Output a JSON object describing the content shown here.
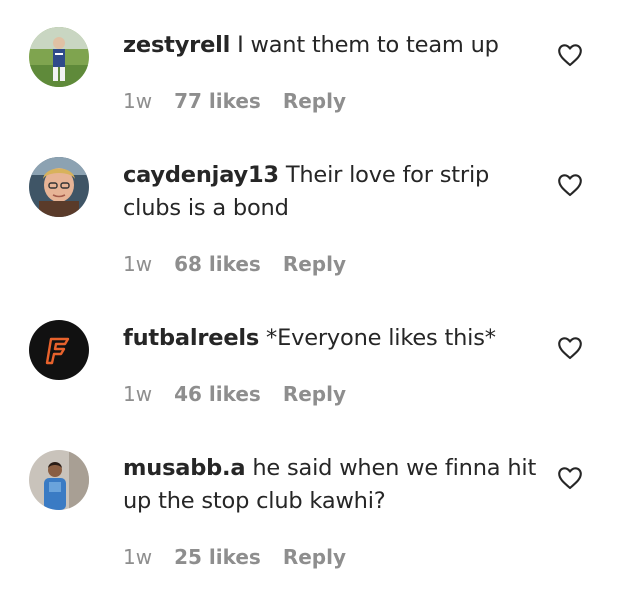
{
  "comments": [
    {
      "username": "zestyrell",
      "text": " I want them to team up",
      "time": "1w",
      "likes": "77 likes",
      "reply": "Reply",
      "avatar": "avatar-photo"
    },
    {
      "username": "caydenjay13",
      "text": " Their love for strip clubs is a bond",
      "time": "1w",
      "likes": "68 likes",
      "reply": "Reply",
      "avatar": "avatar-photo"
    },
    {
      "username": "futbalreels",
      "text": " *Everyone likes this*",
      "time": "1w",
      "likes": "46 likes",
      "reply": "Reply",
      "avatar": "f-logo"
    },
    {
      "username": "musabb.a",
      "text": " he said when we finna hit up the stop club kawhi?",
      "time": "1w",
      "likes": "25 likes",
      "reply": "Reply",
      "avatar": "avatar-photo"
    }
  ],
  "icons": {
    "like": "heart-outline-icon"
  },
  "colors": {
    "text": "#262626",
    "secondary": "#8e8e8e",
    "logo_bg": "#111111",
    "logo_accent": "#e8622c"
  }
}
